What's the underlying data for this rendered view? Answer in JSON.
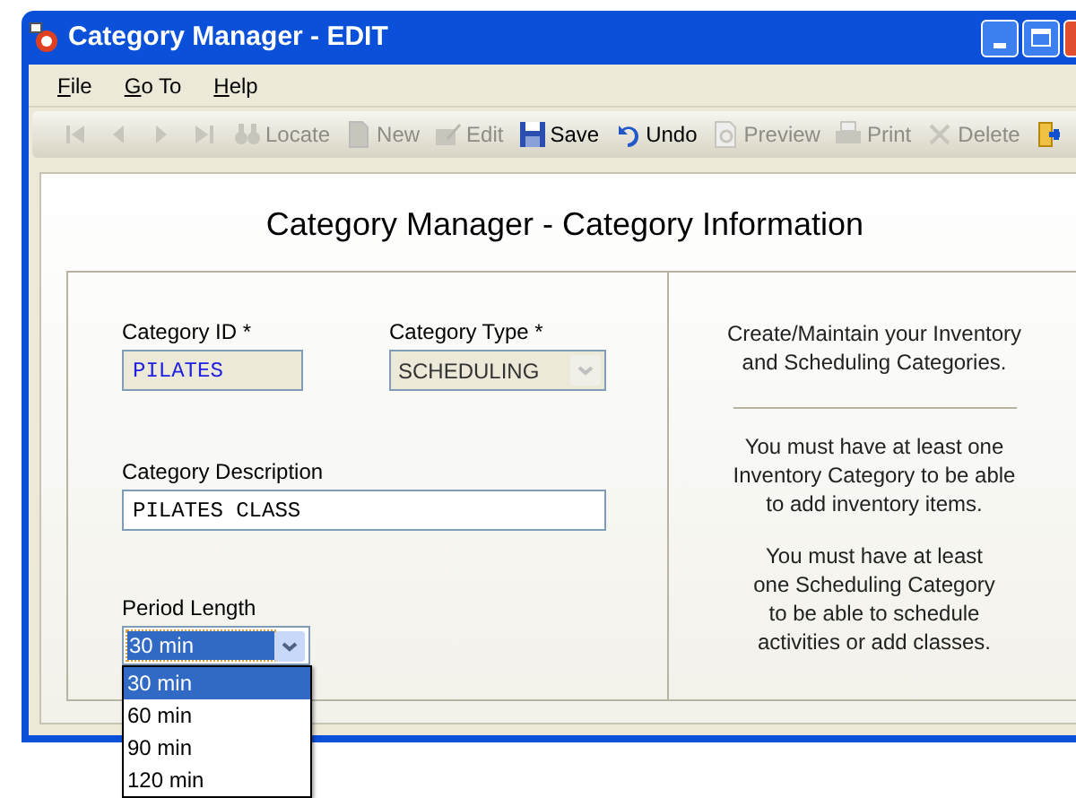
{
  "window": {
    "title": "Category Manager - EDIT"
  },
  "menu": [
    {
      "label": "File"
    },
    {
      "label": "Go To"
    },
    {
      "label": "Help"
    }
  ],
  "toolbar": [
    {
      "kind": "first",
      "disabled": true
    },
    {
      "kind": "prev",
      "disabled": true
    },
    {
      "kind": "next",
      "disabled": true
    },
    {
      "kind": "last",
      "disabled": true
    },
    {
      "kind": "locate",
      "label": "Locate",
      "disabled": true
    },
    {
      "kind": "new",
      "label": "New",
      "disabled": true
    },
    {
      "kind": "edit",
      "label": "Edit",
      "disabled": true
    },
    {
      "kind": "save",
      "label": "Save",
      "disabled": false
    },
    {
      "kind": "undo",
      "label": "Undo",
      "disabled": false
    },
    {
      "kind": "preview",
      "label": "Preview",
      "disabled": true
    },
    {
      "kind": "print",
      "label": "Print",
      "disabled": true
    },
    {
      "kind": "delete",
      "label": "Delete",
      "disabled": true
    },
    {
      "kind": "exit",
      "disabled": false
    }
  ],
  "heading": "Category Manager - Category Information",
  "form": {
    "category_id": {
      "label": "Category ID *",
      "value": "PILATES"
    },
    "category_type": {
      "label": "Category Type *",
      "value": "SCHEDULING",
      "disabled": true
    },
    "description": {
      "label": "Category Description",
      "value": "PILATES CLASS"
    },
    "period_length": {
      "label": "Period Length",
      "value": "30 min",
      "expanded": true,
      "options": [
        {
          "label": "30 min",
          "selected": true
        },
        {
          "label": "60 min",
          "selected": false
        },
        {
          "label": "90 min",
          "selected": false
        },
        {
          "label": "120 min",
          "selected": false
        }
      ]
    }
  },
  "info": [
    {
      "lines": [
        "Create/Maintain your Inventory",
        "and Scheduling Categories."
      ]
    },
    {
      "lines": [
        "You must have at least one",
        "Inventory Category to be able",
        "to add inventory items."
      ]
    },
    {
      "lines": [
        "You must have at least",
        "one Scheduling Category",
        "to be able to schedule",
        "activities or add classes."
      ]
    }
  ]
}
